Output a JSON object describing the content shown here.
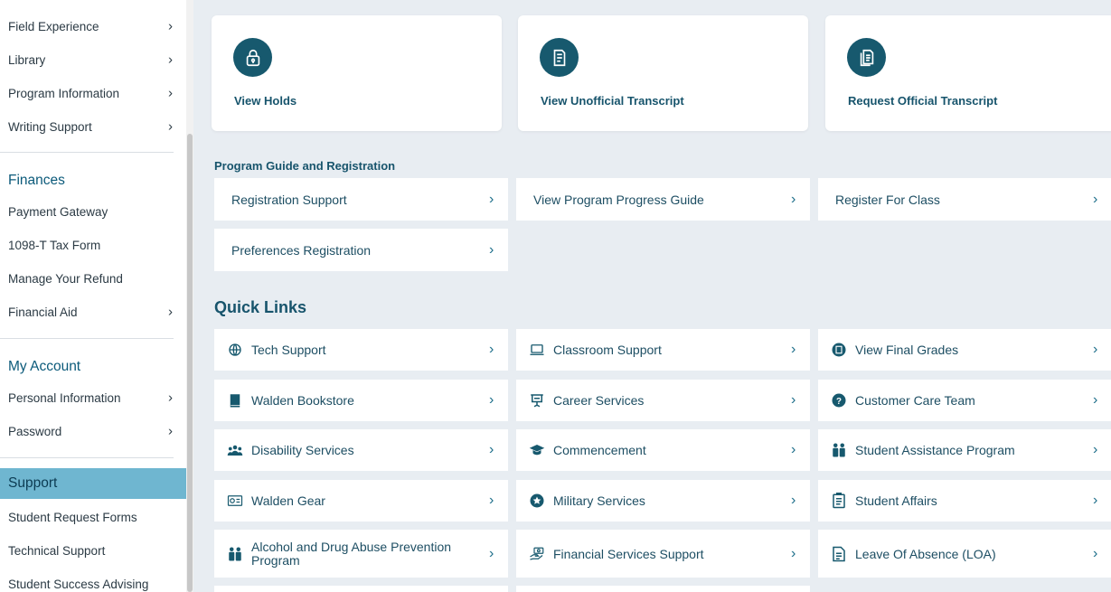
{
  "sidebar": {
    "academics_items": [
      {
        "label": "Field Experience"
      },
      {
        "label": "Library"
      },
      {
        "label": "Program Information"
      },
      {
        "label": "Writing Support"
      }
    ],
    "finances_header": "Finances",
    "finances_items": [
      {
        "label": "Payment Gateway"
      },
      {
        "label": "1098-T Tax Form"
      },
      {
        "label": "Manage Your Refund"
      },
      {
        "label": "Financial Aid"
      }
    ],
    "account_header": "My Account",
    "account_items": [
      {
        "label": "Personal Information"
      },
      {
        "label": "Password"
      }
    ],
    "support_header": "Support",
    "support_items": [
      {
        "label": "Student Request Forms"
      },
      {
        "label": "Technical Support"
      },
      {
        "label": "Student Success Advising"
      }
    ],
    "chevron": "›"
  },
  "cards": [
    {
      "label": "View Holds",
      "icon": "lock-icon"
    },
    {
      "label": "View Unofficial Transcript",
      "icon": "document-icon"
    },
    {
      "label": "Request Official Transcript",
      "icon": "documents-icon"
    }
  ],
  "program_section": {
    "title": "Program Guide and Registration",
    "links": [
      {
        "label": "Registration Support"
      },
      {
        "label": "View Program Progress Guide"
      },
      {
        "label": "Register For Class"
      },
      {
        "label": "Preferences Registration"
      }
    ]
  },
  "quick_links": {
    "title": "Quick Links",
    "links": [
      {
        "label": "Tech Support",
        "icon": "globe-icon"
      },
      {
        "label": "Classroom Support",
        "icon": "laptop-icon"
      },
      {
        "label": "View Final Grades",
        "icon": "grades-icon"
      },
      {
        "label": "Walden Bookstore",
        "icon": "book-icon"
      },
      {
        "label": "Career Services",
        "icon": "presentation-icon"
      },
      {
        "label": "Customer Care Team",
        "icon": "question-icon"
      },
      {
        "label": "Disability Services",
        "icon": "people-group-icon"
      },
      {
        "label": "Commencement",
        "icon": "graduation-cap-icon"
      },
      {
        "label": "Student Assistance Program",
        "icon": "two-people-icon"
      },
      {
        "label": "Walden Gear",
        "icon": "gear-card-icon"
      },
      {
        "label": "Military Services",
        "icon": "star-badge-icon"
      },
      {
        "label": "Student Affairs",
        "icon": "clipboard-icon"
      },
      {
        "label": "Alcohol and Drug Abuse Prevention Program",
        "line1": "Alcohol and Drug Abuse Prevention",
        "line2": "Program",
        "icon": "two-people-icon"
      },
      {
        "label": "Financial Services Support",
        "icon": "money-hand-icon"
      },
      {
        "label": "Leave Of Absence (LOA)",
        "icon": "document-list-icon"
      }
    ]
  },
  "colors": {
    "accent": "#17596e",
    "active": "#6fb6d0",
    "background": "#e8edf2"
  }
}
